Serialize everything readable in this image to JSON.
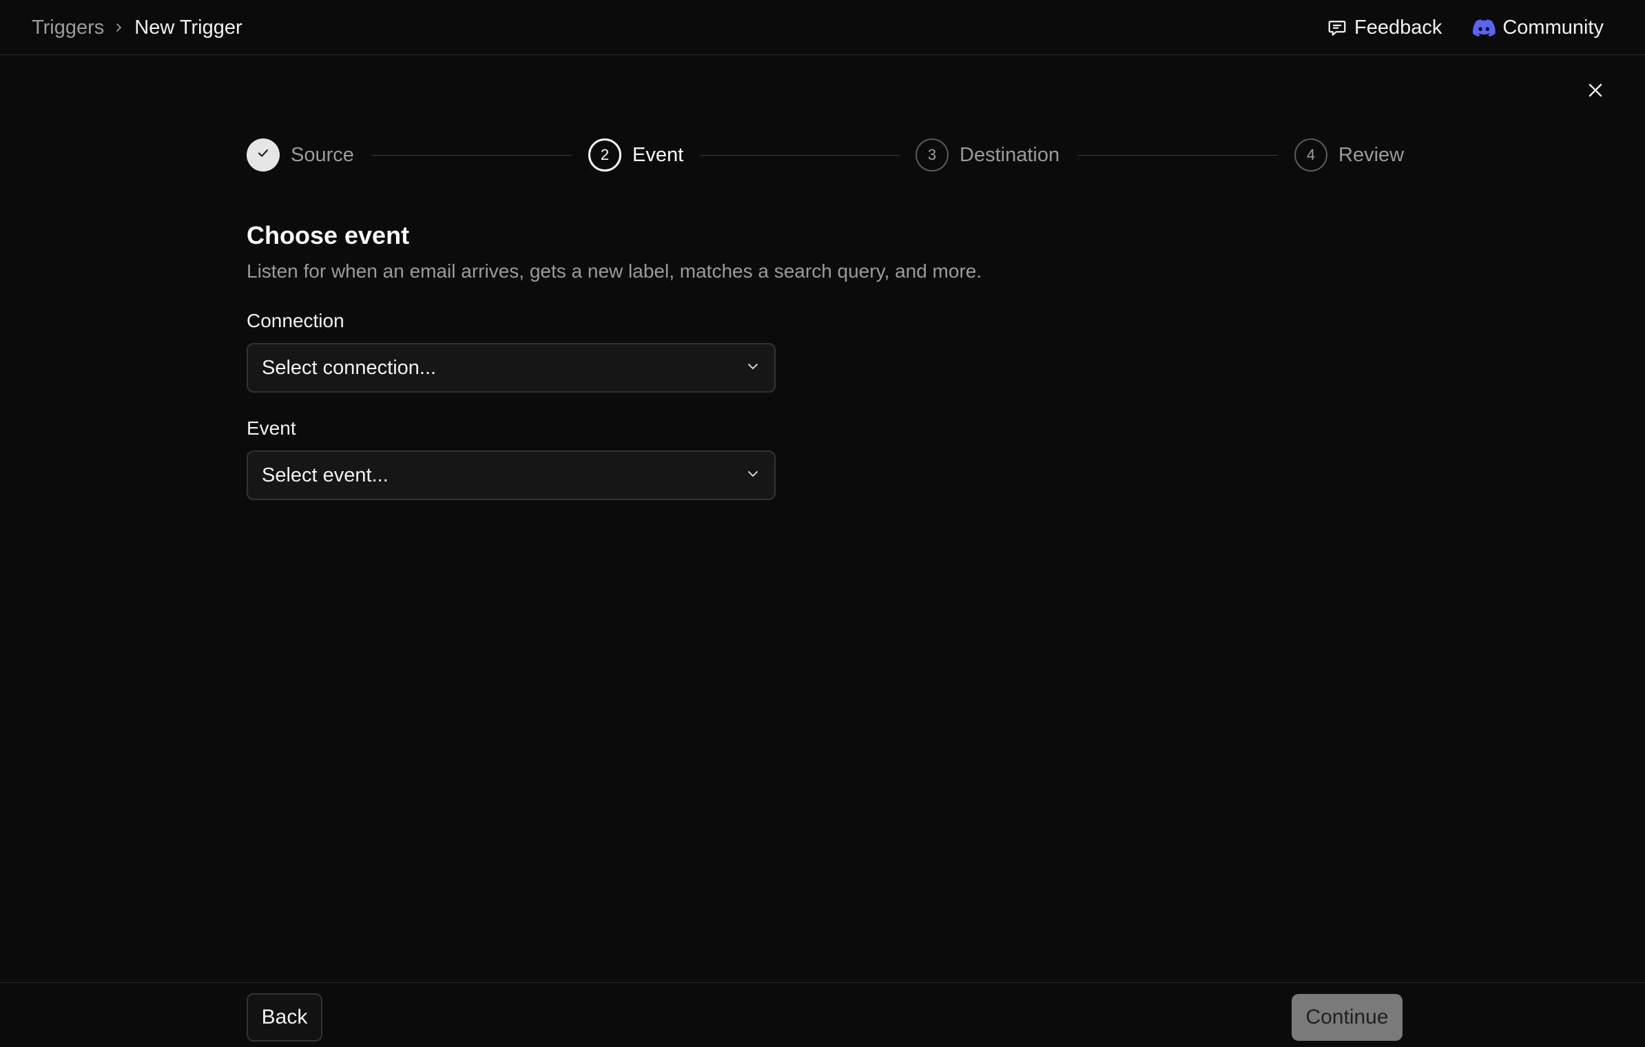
{
  "breadcrumb": {
    "parent": "Triggers",
    "current": "New Trigger"
  },
  "top_actions": {
    "feedback_label": "Feedback",
    "community_label": "Community"
  },
  "stepper": {
    "steps": [
      {
        "number": "1",
        "label": "Source",
        "state": "done"
      },
      {
        "number": "2",
        "label": "Event",
        "state": "active"
      },
      {
        "number": "3",
        "label": "Destination",
        "state": "upcoming"
      },
      {
        "number": "4",
        "label": "Review",
        "state": "upcoming"
      }
    ]
  },
  "main": {
    "title": "Choose event",
    "description": "Listen for when an email arrives, gets a new label, matches a search query, and more.",
    "connection": {
      "label": "Connection",
      "placeholder": "Select connection..."
    },
    "event": {
      "label": "Event",
      "placeholder": "Select event..."
    }
  },
  "footer": {
    "back_label": "Back",
    "continue_label": "Continue"
  },
  "colors": {
    "background": "#0b0b0b",
    "community_icon": "#5865f2",
    "continue_button": "#7a7a7a"
  },
  "icons": {
    "feedback": "message-square-icon",
    "community": "discord-icon",
    "close": "close-icon",
    "chevron": "chevron-down-icon",
    "check": "check-icon"
  }
}
